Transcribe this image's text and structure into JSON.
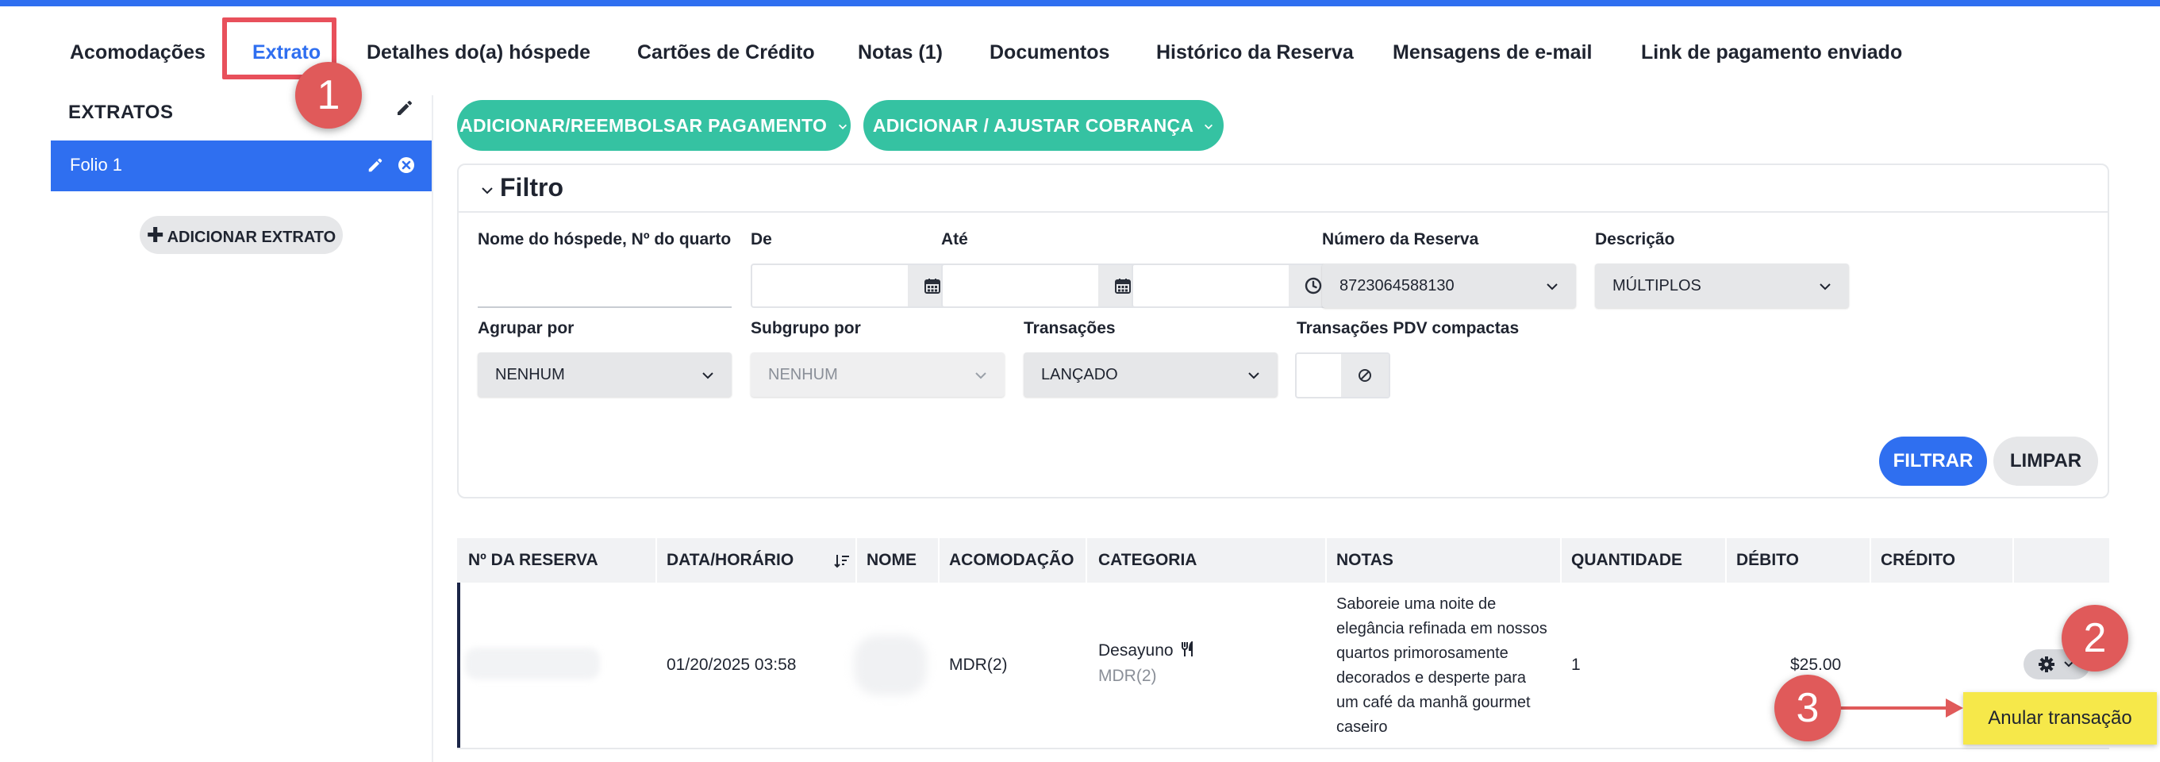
{
  "tabs": [
    {
      "label": "Acomodações"
    },
    {
      "label": "Extrato",
      "active": true
    },
    {
      "label": "Detalhes do(a) hóspede"
    },
    {
      "label": "Cartões de Crédito"
    },
    {
      "label": "Notas (1)"
    },
    {
      "label": "Documentos"
    },
    {
      "label": "Histórico da Reserva"
    },
    {
      "label": "Mensagens de e-mail"
    },
    {
      "label": "Link de pagamento enviado"
    }
  ],
  "steps": [
    "1",
    "2",
    "3"
  ],
  "sidebar": {
    "title": "EXTRATOS",
    "folios": [
      {
        "label": "Folio 1"
      }
    ],
    "add_label": "ADICIONAR EXTRATO"
  },
  "actions": {
    "payment_label": "ADICIONAR/REEMBOLSAR PAGAMENTO",
    "charge_label": "ADICIONAR / AJUSTAR COBRANÇA"
  },
  "filter": {
    "title": "Filtro",
    "guest_label": "Nome do hóspede, Nº do quarto",
    "guest_value": "",
    "from_label": "De",
    "from_value": "",
    "to_label": "Até",
    "to_value": "",
    "time_value": "",
    "reservation_label": "Número da Reserva",
    "reservation_value": "8723064588130",
    "description_label": "Descrição",
    "description_value": "MÚLTIPLOS",
    "group_label": "Agrupar por",
    "group_value": "NENHUM",
    "subgroup_label": "Subgrupo por",
    "subgroup_value": "NENHUM",
    "transactions_label": "Transações",
    "transactions_value": "LANÇADO",
    "compact_label": "Transações PDV compactas",
    "filter_button": "FILTRAR",
    "clear_button": "LIMPAR"
  },
  "table": {
    "headers": [
      "Nº DA RESERVA",
      "DATA/HORÁRIO",
      "NOME",
      "ACOMODAÇÃO",
      "CATEGORIA",
      "NOTAS",
      "QUANTIDADE",
      "DÉBITO",
      "CRÉDITO"
    ],
    "rows": [
      {
        "reservation": "",
        "datetime": "01/20/2025 03:58",
        "name": "",
        "accommodation": "MDR(2)",
        "category": "Desayuno",
        "category_sub": "MDR(2)",
        "notes": "Saboreie uma noite de elegância refinada em nossos quartos primorosamente decorados e desperte para um café da manhã gourmet caseiro",
        "quantity": "1",
        "debit": "$25.00",
        "credit": ""
      }
    ]
  },
  "tooltip": {
    "label": "Anular transação"
  },
  "colors": {
    "primary": "#2f6ff0",
    "accent": "#35c2a2",
    "annotation": "#e05a5a",
    "tooltip": "#f6e84a"
  }
}
